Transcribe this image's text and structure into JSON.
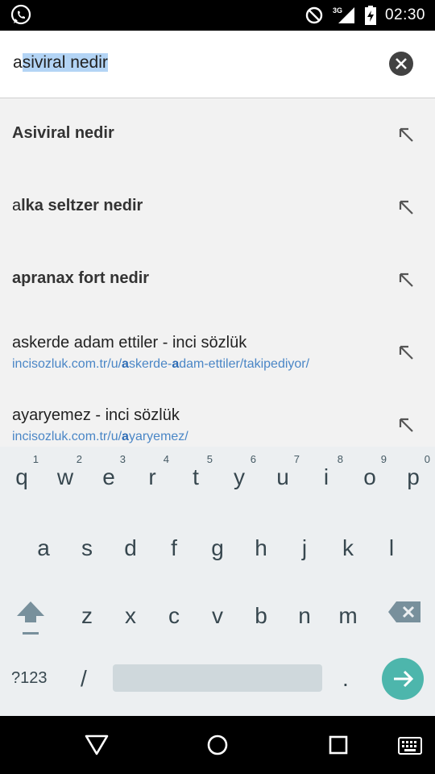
{
  "status_bar": {
    "time": "02:30",
    "network": "3G",
    "icons": [
      "whatsapp-icon",
      "do-not-disturb-icon",
      "signal-icon",
      "battery-icon"
    ]
  },
  "search": {
    "query_prefix": "a",
    "query_selected": "siviral nedir"
  },
  "suggestions": [
    {
      "bold_prefix": "A",
      "bold_rest": "siviral nedir"
    },
    {
      "normal_prefix": "a",
      "bold_rest": "lka seltzer nedir"
    },
    {
      "bold_prefix": "a",
      "bold_rest": "pranax fort nedir"
    },
    {
      "title": "askerde adam ettiler - inci sözlük",
      "url_a": "incisozluk.com.tr/u/",
      "url_b": "a",
      "url_c": "skerde-",
      "url_d": "a",
      "url_e": "dam-ettiler/takipediyor/"
    },
    {
      "title": "ayaryemez - inci sözlük",
      "url_a": "incisozluk.com.tr/u/",
      "url_b": "a",
      "url_c": "yaryemez/"
    }
  ],
  "keyboard": {
    "row1": [
      {
        "ch": "q",
        "hint": "1"
      },
      {
        "ch": "w",
        "hint": "2"
      },
      {
        "ch": "e",
        "hint": "3"
      },
      {
        "ch": "r",
        "hint": "4"
      },
      {
        "ch": "t",
        "hint": "5"
      },
      {
        "ch": "y",
        "hint": "6"
      },
      {
        "ch": "u",
        "hint": "7"
      },
      {
        "ch": "i",
        "hint": "8"
      },
      {
        "ch": "o",
        "hint": "9"
      },
      {
        "ch": "p",
        "hint": "0"
      }
    ],
    "row2": [
      "a",
      "s",
      "d",
      "f",
      "g",
      "h",
      "j",
      "k",
      "l"
    ],
    "row3": [
      "z",
      "x",
      "c",
      "v",
      "b",
      "n",
      "m"
    ],
    "symbols_label": "?123",
    "slash_label": "/",
    "period_label": ".",
    "accent_color": "#4db6ac"
  }
}
